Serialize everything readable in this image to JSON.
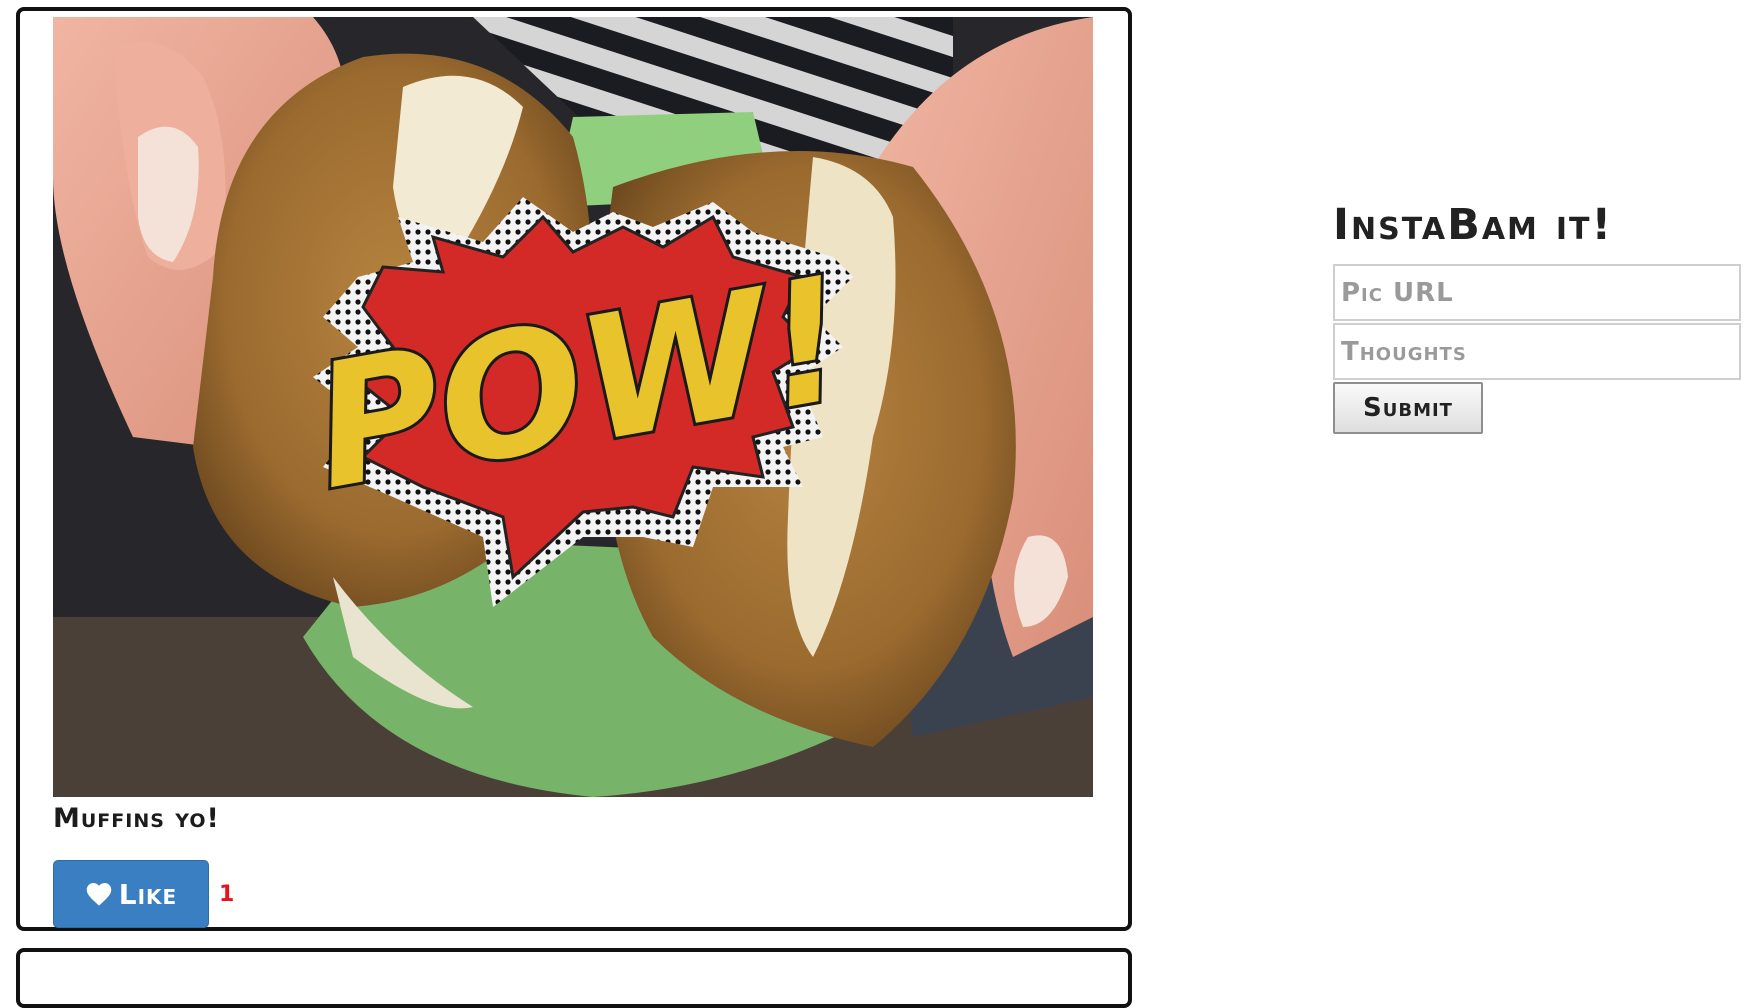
{
  "post": {
    "image_alt": "Muffin broken in half with a POW! comic burst",
    "pow_text": "POW!",
    "caption": "Muffins yo!",
    "like_label": "Like",
    "like_count": "1"
  },
  "form": {
    "title": "InstaBam it!",
    "pic_url_placeholder": "Pic URL",
    "pic_url_value": "",
    "thoughts_placeholder": "Thoughts",
    "thoughts_value": "",
    "submit_label": "Submit"
  },
  "colors": {
    "like_button": "#3a7fc1",
    "like_count": "#e8121b",
    "card_border": "#111111",
    "pow_red": "#d42a27",
    "pow_yellow": "#e9c32c"
  },
  "icons": {
    "like_icon": "heart-icon"
  }
}
